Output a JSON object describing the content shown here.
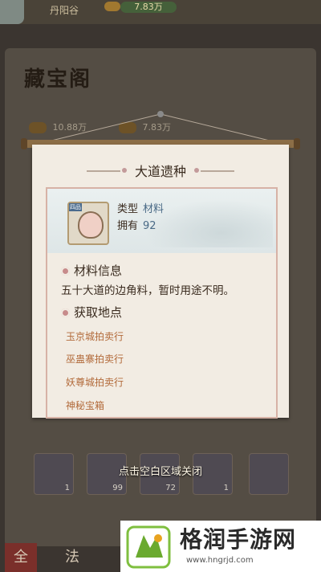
{
  "header": {
    "player_name": "丹阳谷",
    "gold_amount": "7.83万"
  },
  "treasure_pavilion": {
    "title": "藏宝阁",
    "resource_1": "10.88万",
    "resource_2": "7.83万"
  },
  "inventory_slots": [
    "1",
    "99",
    "72",
    "1",
    ""
  ],
  "bottom_tabs": [
    "全",
    "法"
  ],
  "popup": {
    "item_name": "大道遗种",
    "grade_tag": "四品",
    "type_label": "类型",
    "type_value": "材料",
    "owned_label": "拥有",
    "owned_value": "92",
    "info_title": "材料信息",
    "description": "五十大道的边角料，暂时用途不明。",
    "source_title": "获取地点",
    "sources": [
      "玉京城拍卖行",
      "巫蛊寨拍卖行",
      "妖尊城拍卖行",
      "神秘宝箱"
    ],
    "close_hint": "点击空白区域关闭"
  },
  "watermark": {
    "title": "格润手游网",
    "url": "www.hngrjd.com"
  },
  "colors": {
    "accent": "#b26a3a",
    "frame": "#d7b2a6",
    "value": "#4a6a86"
  }
}
